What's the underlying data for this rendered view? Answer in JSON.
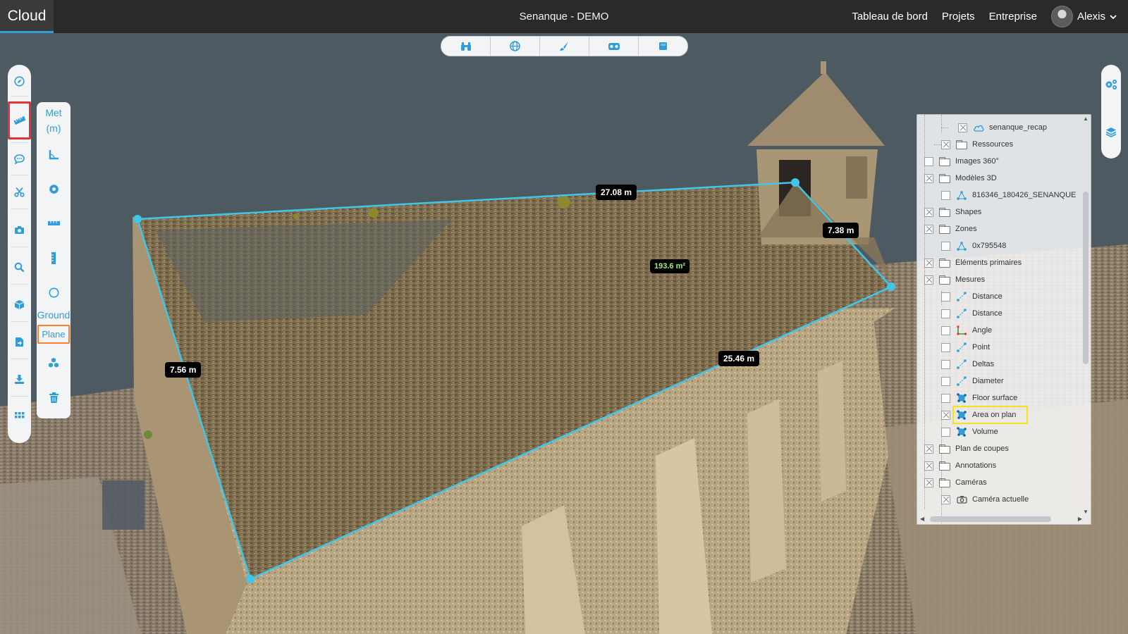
{
  "header": {
    "brand": "Cloud",
    "project_title": "Senanque - DEMO",
    "nav": [
      "Tableau de bord",
      "Projets",
      "Entreprise"
    ],
    "user_name": "Alexis"
  },
  "measurements": {
    "edge_top": "27.08 m",
    "edge_right": "7.38 m",
    "edge_left": "7.56 m",
    "edge_bottom": "25.46 m",
    "area": "193.6 m²"
  },
  "center_toolbar": {
    "icons": [
      "binoculars-icon",
      "globe-icon",
      "brush-icon",
      "vr-headset-icon",
      "square-icon"
    ]
  },
  "left_toolbar": {
    "icons": [
      "compass-icon",
      "ruler-icon",
      "comment-icon",
      "scissors-icon",
      "camera-icon",
      "search-icon",
      "cube-icon",
      "document-icon",
      "download-icon",
      "grid-icon"
    ],
    "active": "ruler-icon"
  },
  "measure_panel": {
    "unit_line1": "Met",
    "unit_line2": "(m)",
    "ground_label": "Ground",
    "plane_label": "Plane"
  },
  "right_toolbar": {
    "icons": [
      "settings-icon",
      "layers-icon"
    ]
  },
  "layer_tree": {
    "items": [
      {
        "label": "senanque_recap",
        "level": 2,
        "icon": "cloud",
        "checked": true
      },
      {
        "label": "Ressources",
        "level": 1,
        "icon": "folder",
        "checked": true
      },
      {
        "label": "Images 360°",
        "level": 0,
        "icon": "folder",
        "checked": false
      },
      {
        "label": "Modèles 3D",
        "level": 0,
        "icon": "folder",
        "checked": true
      },
      {
        "label": "816346_180426_SENANQUE",
        "level": 1,
        "icon": "model",
        "checked": false
      },
      {
        "label": "Shapes",
        "level": 0,
        "icon": "folder",
        "checked": true
      },
      {
        "label": "Zones",
        "level": 0,
        "icon": "folder",
        "checked": true
      },
      {
        "label": "0x795548",
        "level": 1,
        "icon": "model",
        "checked": false
      },
      {
        "label": "Éléments primaires",
        "level": 0,
        "icon": "folder",
        "checked": true
      },
      {
        "label": "Mesures",
        "level": 0,
        "icon": "folder",
        "checked": true
      },
      {
        "label": "Distance",
        "level": 1,
        "icon": "distance",
        "checked": false
      },
      {
        "label": "Distance",
        "level": 1,
        "icon": "distance",
        "checked": false
      },
      {
        "label": "Angle",
        "level": 1,
        "icon": "angle",
        "checked": false
      },
      {
        "label": "Point",
        "level": 1,
        "icon": "distance",
        "checked": false
      },
      {
        "label": "Deltas",
        "level": 1,
        "icon": "distance",
        "checked": false
      },
      {
        "label": "Diameter",
        "level": 1,
        "icon": "distance",
        "checked": false
      },
      {
        "label": "Floor surface",
        "level": 1,
        "icon": "area",
        "checked": false
      },
      {
        "label": "Area on plan",
        "level": 1,
        "icon": "area",
        "checked": true,
        "highlight": true
      },
      {
        "label": "Volume",
        "level": 1,
        "icon": "area",
        "checked": false
      },
      {
        "label": "Plan de coupes",
        "level": 0,
        "icon": "folder",
        "checked": true
      },
      {
        "label": "Annotations",
        "level": 0,
        "icon": "folder",
        "checked": true
      },
      {
        "label": "Caméras",
        "level": 0,
        "icon": "folder",
        "checked": true
      },
      {
        "label": "Caméra actuelle",
        "level": 1,
        "icon": "camera",
        "checked": true
      }
    ]
  },
  "colors": {
    "accent": "#2f9ed8",
    "measure_line": "#3fc6e8",
    "active_tool_outline": "#e0333c",
    "plane_outline": "#ff7f2a",
    "highlight_outline": "#f5e31a",
    "area_text": "#9df27c"
  }
}
